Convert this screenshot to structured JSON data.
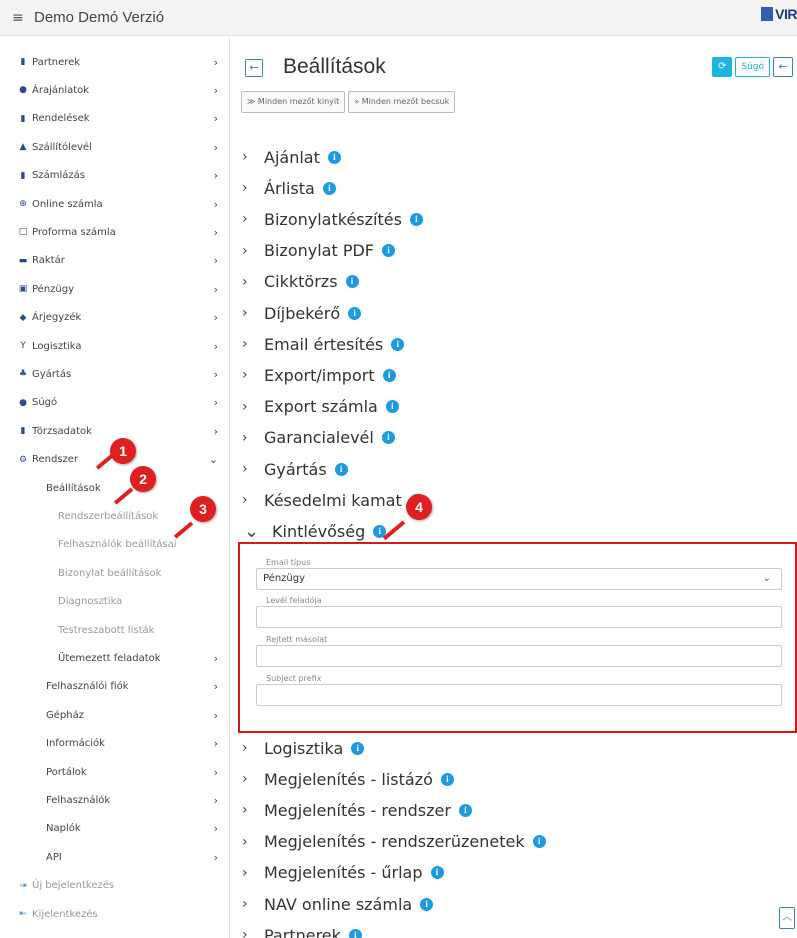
{
  "app": {
    "title": "Demo Demó Verzió",
    "logo_text": "VIR"
  },
  "sidebar": {
    "items": [
      {
        "label": "Partnerek",
        "icon": "partner-icon",
        "glyph": "▮",
        "has_chevron": true
      },
      {
        "label": "Árajánlatok",
        "icon": "quote-icon",
        "glyph": "●",
        "has_chevron": true
      },
      {
        "label": "Rendelések",
        "icon": "order-icon",
        "glyph": "▮",
        "has_chevron": true
      },
      {
        "label": "Szállítólevél",
        "icon": "delivery-icon",
        "glyph": "▲",
        "has_chevron": true
      },
      {
        "label": "Számlázás",
        "icon": "invoice-icon",
        "glyph": "▮",
        "has_chevron": true
      },
      {
        "label": "Online számla",
        "icon": "globe-icon",
        "glyph": "⊕",
        "has_chevron": true
      },
      {
        "label": "Proforma számla",
        "icon": "proforma-icon",
        "glyph": "□",
        "has_chevron": true
      },
      {
        "label": "Raktár",
        "icon": "warehouse-icon",
        "glyph": "▬",
        "has_chevron": true
      },
      {
        "label": "Pénzügy",
        "icon": "money-icon",
        "glyph": "▣",
        "has_chevron": true
      },
      {
        "label": "Árjegyzék",
        "icon": "pricelist-icon",
        "glyph": "◆",
        "has_chevron": true
      },
      {
        "label": "Logisztika",
        "icon": "logistics-icon",
        "glyph": "Y",
        "has_chevron": true
      },
      {
        "label": "Gyártás",
        "icon": "production-icon",
        "glyph": "♣",
        "has_chevron": true
      },
      {
        "label": "Súgó",
        "icon": "help-icon",
        "glyph": "●",
        "has_chevron": true
      },
      {
        "label": "Törzsadatok",
        "icon": "masterdata-icon",
        "glyph": "▮",
        "has_chevron": true
      },
      {
        "label": "Rendszer",
        "icon": "system-icon",
        "glyph": "⚙",
        "has_chevron": true,
        "expanded": true
      }
    ],
    "system_children": [
      {
        "label": "Beállítások",
        "level": 1,
        "has_chevron": false
      },
      {
        "label": "Rendszerbeállítások",
        "level": 2,
        "has_chevron": false
      },
      {
        "label": "Felhasználók beállításai",
        "level": 2,
        "has_chevron": false
      },
      {
        "label": "Bizonylat beállítások",
        "level": 2,
        "has_chevron": false
      },
      {
        "label": "Diagnosztika",
        "level": 2,
        "has_chevron": false
      },
      {
        "label": "Testreszabott listák",
        "level": 2,
        "has_chevron": false
      },
      {
        "label": "Ütemezett feladatok",
        "level": 2,
        "has_chevron": true,
        "dark": true
      },
      {
        "label": "Felhasználói fiók",
        "level": 1,
        "has_chevron": true
      },
      {
        "label": "Gépház",
        "level": 1,
        "has_chevron": true
      },
      {
        "label": "Információk",
        "level": 1,
        "has_chevron": true
      },
      {
        "label": "Portálok",
        "level": 1,
        "has_chevron": true
      },
      {
        "label": "Felhasználók",
        "level": 1,
        "has_chevron": true
      },
      {
        "label": "Naplók",
        "level": 1,
        "has_chevron": true
      },
      {
        "label": "API",
        "level": 1,
        "has_chevron": true
      }
    ],
    "footer": [
      {
        "label": "Új bejelentkezés",
        "icon": "login-icon",
        "glyph": "⇥"
      },
      {
        "label": "Kijelentkezés",
        "icon": "logout-icon",
        "glyph": "⇤"
      }
    ]
  },
  "callouts": [
    "1",
    "2",
    "3",
    "4"
  ],
  "main": {
    "title": "Beállítások",
    "help_label": "Súgó",
    "expand_all_label": "Minden mezőt kinyit",
    "collapse_all_label": "Minden mezőt becsuk",
    "sections_before": [
      "Ajánlat",
      "Árlista",
      "Bizonylatkészítés",
      "Bizonylat PDF",
      "Cikktörzs",
      "Díjbekérő",
      "Email értesítés",
      "Export/import",
      "Export számla",
      "Garancialevél",
      "Gyártás",
      "Késedelmi kamat"
    ],
    "open_section": "Kintlévőség",
    "fields": [
      {
        "label": "Email típus",
        "value": "Pénzügy",
        "is_select": true
      },
      {
        "label": "Levél feladója",
        "value": ""
      },
      {
        "label": "Rejtett másolat",
        "value": ""
      },
      {
        "label": "Subject prefix",
        "value": ""
      }
    ],
    "sections_after": [
      "Logisztika",
      "Megjelenítés - listázó",
      "Megjelenítés - rendszer",
      "Megjelenítés - rendszerüzenetek",
      "Megjelenítés - űrlap",
      "NAV online számla",
      "Partnerek"
    ]
  },
  "colors": {
    "accent": "#1e9be0",
    "callout": "#e02020",
    "highlight_border": "#d21a1a"
  }
}
